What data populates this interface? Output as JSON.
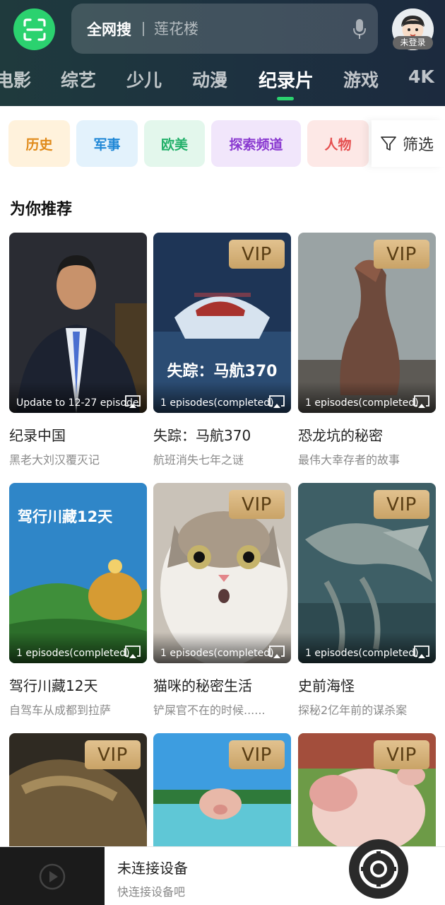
{
  "header": {
    "search": {
      "scope": "全网搜",
      "placeholder": "莲花楼"
    },
    "user": {
      "status": "未登录"
    },
    "tabs": [
      {
        "label": "电影"
      },
      {
        "label": "综艺"
      },
      {
        "label": "少儿"
      },
      {
        "label": "动漫"
      },
      {
        "label": "纪录片",
        "active": true
      },
      {
        "label": "游戏"
      },
      {
        "label": "4K"
      }
    ]
  },
  "categories": [
    {
      "label": "历史",
      "text_color": "#e08a1a",
      "bg_color": "#fff2dc"
    },
    {
      "label": "军事",
      "text_color": "#1f87d6",
      "bg_color": "#e3f2fc"
    },
    {
      "label": "欧美",
      "text_color": "#23b06a",
      "bg_color": "#e3f7ec"
    },
    {
      "label": "探索频道",
      "text_color": "#8a3ad0",
      "bg_color": "#f1e6fb"
    },
    {
      "label": "人物",
      "text_color": "#e54f4f",
      "bg_color": "#fde8e6"
    }
  ],
  "filter": {
    "label": "筛选"
  },
  "section": {
    "title": "为你推荐"
  },
  "videos": [
    {
      "title": "纪录中国",
      "subtitle": "黑老大刘汉覆灭记",
      "episode": "Update to 12-27 episode",
      "vip": false
    },
    {
      "title": "失踪：马航370",
      "subtitle": "航班消失七年之谜",
      "episode": "1 episodes(completed)",
      "vip": true,
      "vip_label": "VIP",
      "poster_text": "失踪：马航370"
    },
    {
      "title": "恐龙坑的秘密",
      "subtitle": "最伟大幸存者的故事",
      "episode": "1 episodes(completed)",
      "vip": true,
      "vip_label": "VIP"
    },
    {
      "title": "驾行川藏12天",
      "subtitle": "自驾车从成都到拉萨",
      "episode": "1 episodes(completed)",
      "vip": false,
      "poster_text": "驾行川藏12天"
    },
    {
      "title": "猫咪的秘密生活",
      "subtitle": "铲屎官不在的时候......",
      "episode": "1 episodes(completed)",
      "vip": true,
      "vip_label": "VIP"
    },
    {
      "title": "史前海怪",
      "subtitle": "探秘2亿年前的谋杀案",
      "episode": "1 episodes(completed)",
      "vip": true,
      "vip_label": "VIP"
    },
    {
      "vip": true,
      "vip_label": "VIP"
    },
    {
      "vip": true,
      "vip_label": "VIP"
    },
    {
      "vip": true,
      "vip_label": "VIP"
    }
  ],
  "device": {
    "title": "未连接设备",
    "subtitle": "快连接设备吧"
  },
  "colors": {
    "accent": "#2bd26f",
    "vip_gold": "#d4b07a",
    "header_bg": "#1d3140"
  }
}
